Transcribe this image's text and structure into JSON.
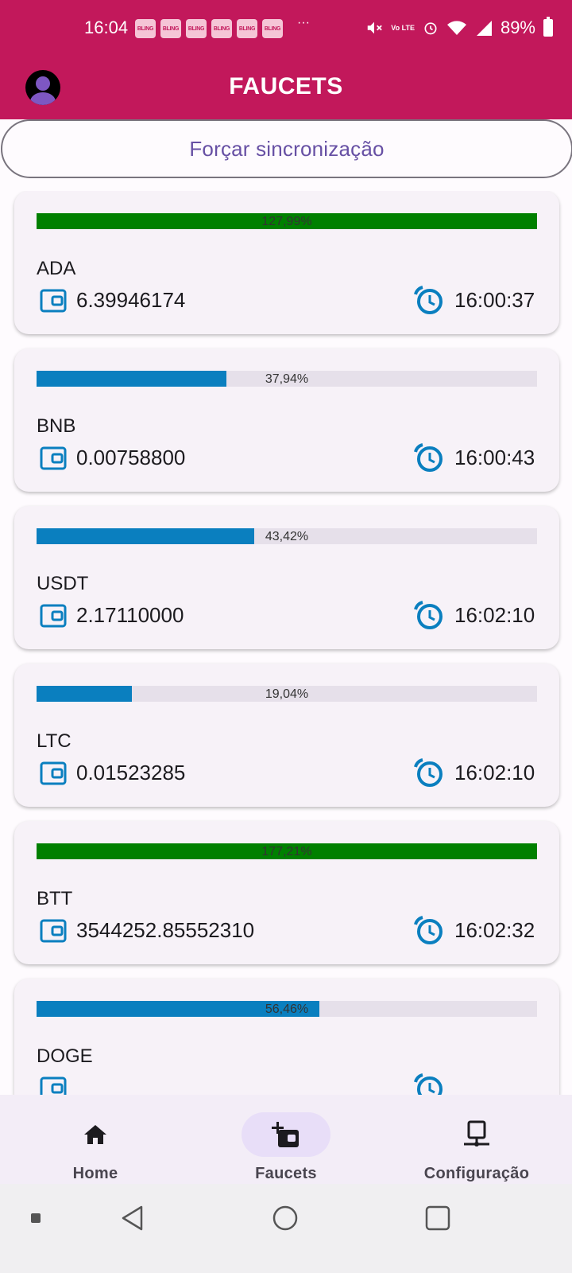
{
  "status_bar": {
    "time": "16:04",
    "notification_label": "BLING",
    "more": "···",
    "battery": "89%",
    "network": "Vo LTE"
  },
  "app_bar": {
    "title": "FAUCETS"
  },
  "sync_button": {
    "label": "Forçar sincronização"
  },
  "faucets": [
    {
      "coin": "ADA",
      "progress_label": "127,99%",
      "progress": 1.0,
      "bar_color": "#008000",
      "balance": "6.39946174",
      "time": "16:00:37"
    },
    {
      "coin": "BNB",
      "progress_label": "37,94%",
      "progress": 0.3794,
      "bar_color": "#0a7fbf",
      "balance": "0.00758800",
      "time": "16:00:43"
    },
    {
      "coin": "USDT",
      "progress_label": "43,42%",
      "progress": 0.4342,
      "bar_color": "#0a7fbf",
      "balance": "2.17110000",
      "time": "16:02:10"
    },
    {
      "coin": "LTC",
      "progress_label": "19,04%",
      "progress": 0.1904,
      "bar_color": "#0a7fbf",
      "balance": "0.01523285",
      "time": "16:02:10"
    },
    {
      "coin": "BTT",
      "progress_label": "177,21%",
      "progress": 1.0,
      "bar_color": "#008000",
      "balance": "3544252.85552310",
      "time": "16:02:32"
    },
    {
      "coin": "DOGE",
      "progress_label": "56,46%",
      "progress": 0.5646,
      "bar_color": "#0a7fbf",
      "balance": "",
      "time": ""
    }
  ],
  "bottom_nav": {
    "items": [
      {
        "label": "Home",
        "icon": "home-icon",
        "active": false
      },
      {
        "label": "Faucets",
        "icon": "wallet-add-icon",
        "active": true
      },
      {
        "label": "Configuração",
        "icon": "monitor-icon",
        "active": false
      }
    ]
  },
  "colors": {
    "primary": "#c2185b",
    "accent_purple": "#6750a4",
    "progress_blue": "#0a7fbf",
    "progress_green": "#008000",
    "icon_blue": "#0a7fbf"
  }
}
